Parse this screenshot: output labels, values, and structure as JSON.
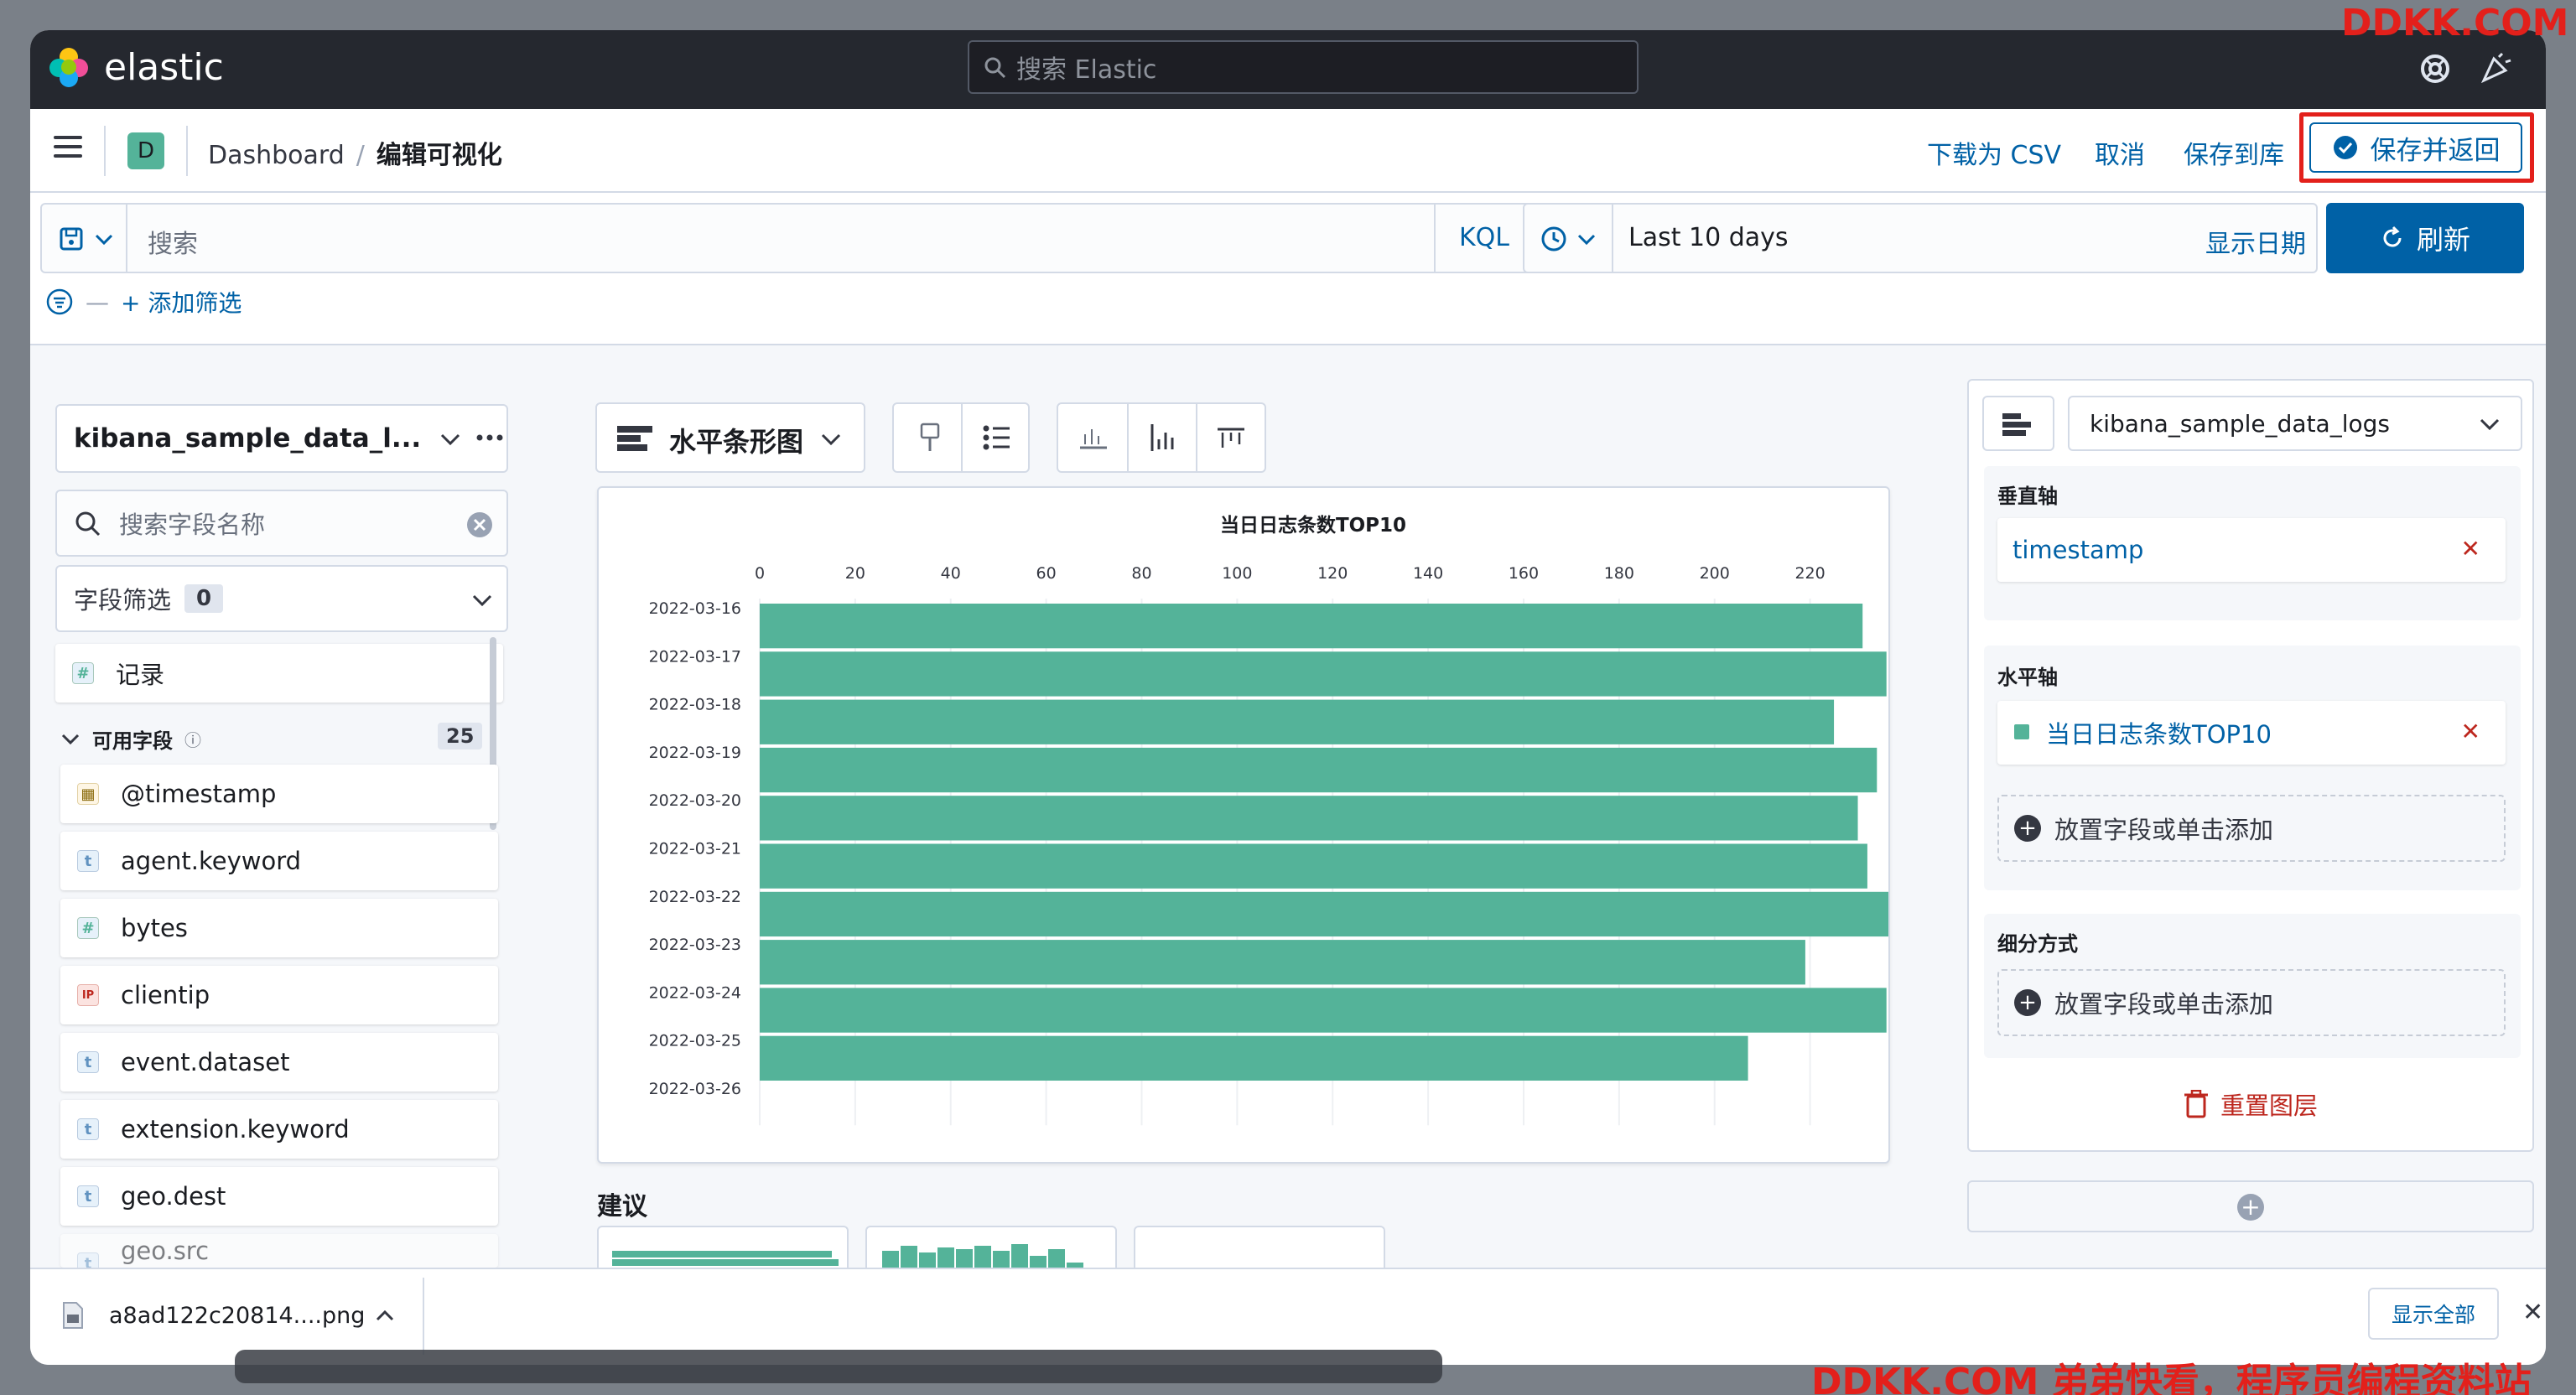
{
  "app": {
    "brand": "elastic",
    "global_search_placeholder": "搜索 Elastic"
  },
  "header": {
    "badge": "D",
    "breadcrumb_root": "Dashboard",
    "breadcrumb_sep": "/",
    "breadcrumb_current": "编辑可视化",
    "download_csv": "下载为 CSV",
    "cancel": "取消",
    "save_to_library": "保存到库",
    "save_and_return": "保存并返回"
  },
  "query": {
    "placeholder": "搜索",
    "language": "KQL",
    "time_range": "Last 10 days",
    "show_dates": "显示日期",
    "refresh": "刷新",
    "add_filter": "+ 添加筛选"
  },
  "left": {
    "index_pattern": "kibana_sample_data_l...",
    "field_search_placeholder": "搜索字段名称",
    "field_filter": "字段筛选",
    "field_filter_count": "0",
    "records": "记录",
    "available_fields": "可用字段",
    "available_count": "25",
    "fields": [
      {
        "name": "@timestamp",
        "type": "date",
        "glyph": "▦"
      },
      {
        "name": "agent.keyword",
        "type": "string",
        "glyph": "t"
      },
      {
        "name": "bytes",
        "type": "number",
        "glyph": "#"
      },
      {
        "name": "clientip",
        "type": "ip",
        "glyph": "IP"
      },
      {
        "name": "event.dataset",
        "type": "string",
        "glyph": "t"
      },
      {
        "name": "extension.keyword",
        "type": "string",
        "glyph": "t"
      },
      {
        "name": "geo.dest",
        "type": "string",
        "glyph": "t"
      },
      {
        "name": "geo.src",
        "type": "string",
        "glyph": "t"
      }
    ]
  },
  "center": {
    "chart_type_label": "水平条形图",
    "suggestions": "建议"
  },
  "chart_data": {
    "type": "bar",
    "orientation": "horizontal",
    "title": "当日日志条数TOP10",
    "categories": [
      "2022-03-16",
      "2022-03-17",
      "2022-03-18",
      "2022-03-19",
      "2022-03-20",
      "2022-03-21",
      "2022-03-22",
      "2022-03-23",
      "2022-03-24",
      "2022-03-25",
      "2022-03-26"
    ],
    "values": [
      231,
      236,
      225,
      234,
      230,
      232,
      237,
      219,
      236,
      207
    ],
    "xlim": [
      0,
      235
    ],
    "xticks": [
      0,
      20,
      40,
      60,
      80,
      100,
      120,
      140,
      160,
      180,
      200,
      220
    ],
    "color": "#54b399",
    "grid": true
  },
  "right": {
    "layer_index": "kibana_sample_data_logs",
    "vertical_axis": "垂直轴",
    "vertical_field": "timestamp",
    "horizontal_axis": "水平轴",
    "horizontal_field": "当日日志条数TOP10",
    "drop_hint": "放置字段或单击添加",
    "breakdown": "细分方式",
    "breakdown_hint": "放置字段或单击添加",
    "reset_layer": "重置图层"
  },
  "downloads": {
    "file": "a8ad122c20814....png",
    "show_all": "显示全部"
  },
  "watermark": {
    "top": "DDKK.COM",
    "bottom": "DDKK.COM 弟弟快看，程序员编程资料站"
  }
}
